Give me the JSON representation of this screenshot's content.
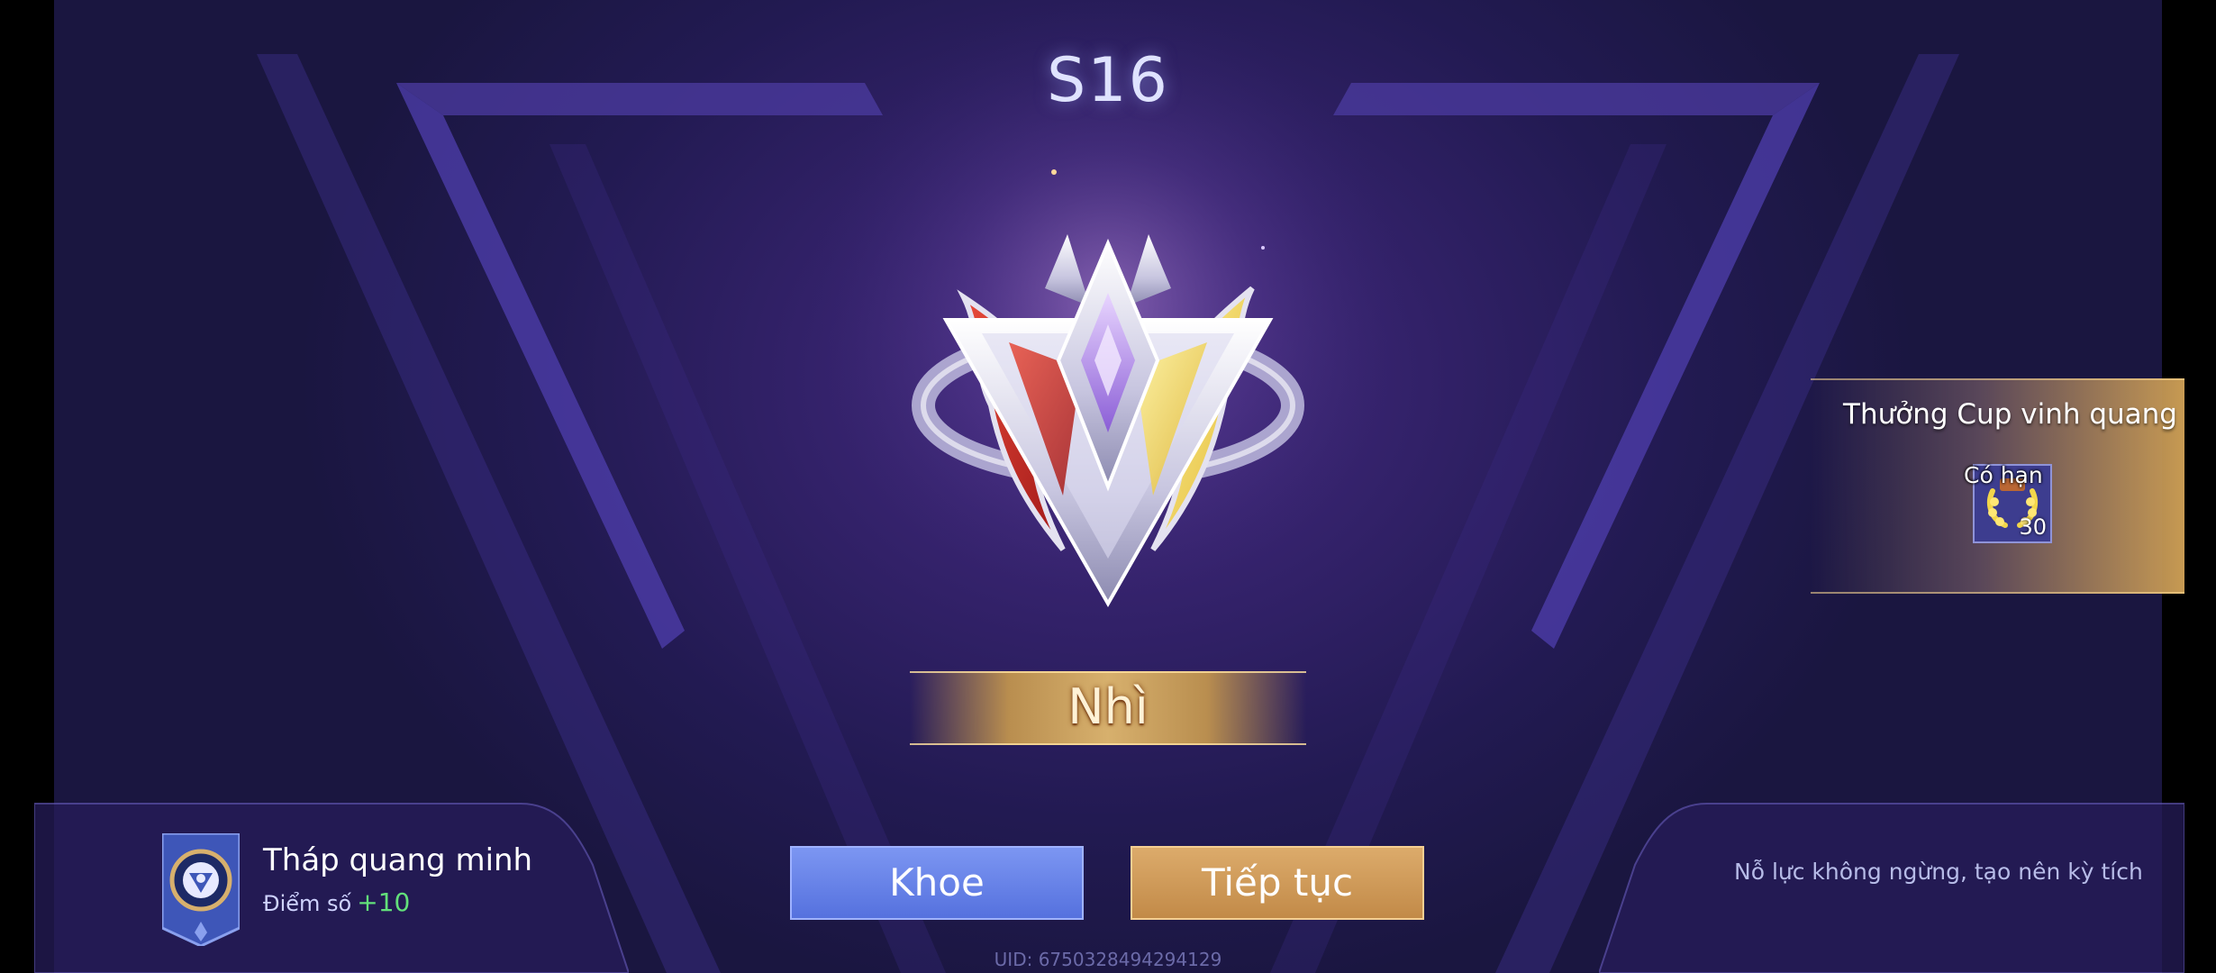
{
  "season": "S16",
  "rank_label": "Nhì",
  "reward": {
    "title": "Thưởng Cup vinh quang",
    "tag": "Có hạn",
    "count": "30",
    "icon": "laurel-wreath-icon"
  },
  "mode": {
    "name": "Tháp quang minh",
    "score_label": "Điểm số",
    "score_delta": "+10",
    "icon": "tower-emblem-icon"
  },
  "buttons": {
    "share_label": "Khoe",
    "continue_label": "Tiếp tục"
  },
  "motto": "Nỗ lực không ngừng, tạo nên kỳ tích",
  "uid": "UID: 6750328494294129",
  "colors": {
    "share_button": "#6a84e8",
    "continue_button": "#d09a58",
    "score_delta": "#62e07a",
    "background": "#2a1d5e"
  }
}
